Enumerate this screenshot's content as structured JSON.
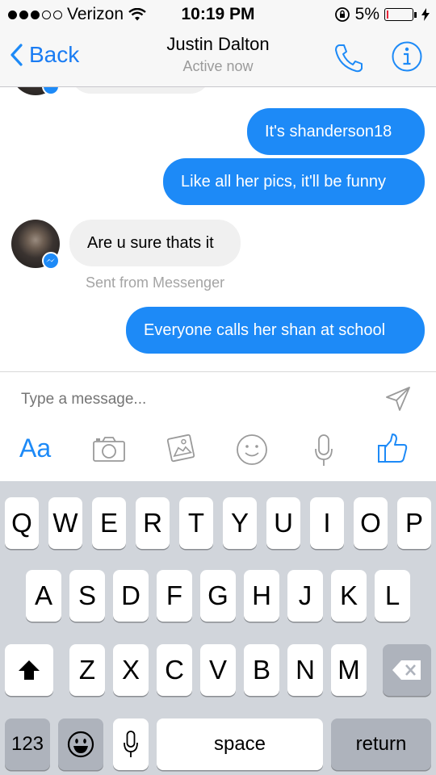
{
  "status_bar": {
    "carrier": "Verizon",
    "time": "10:19 PM",
    "battery": "5%",
    "battery_level": 0.05,
    "signal_bars_filled": 3,
    "signal_bars_total": 5
  },
  "nav": {
    "back_label": "Back",
    "title": "Justin Dalton",
    "subtitle": "Active now",
    "accent_color": "#1d8af7"
  },
  "messages": [
    {
      "direction": "outgoing",
      "text": "It's shanderson18"
    },
    {
      "direction": "outgoing",
      "text": "Like all her pics, it'll be funny"
    },
    {
      "direction": "incoming",
      "text": "Are u sure thats it"
    },
    {
      "direction": "outgoing",
      "text": "Everyone calls her shan at school"
    }
  ],
  "sent_from": "Sent from Messenger",
  "composer": {
    "placeholder": "Type a message...",
    "aa_label": "Aa",
    "tools": [
      "aa-icon",
      "camera-icon",
      "photo-icon",
      "emoji-icon",
      "microphone-icon",
      "like-icon"
    ]
  },
  "keyboard": {
    "row1": [
      "Q",
      "W",
      "E",
      "R",
      "T",
      "Y",
      "U",
      "I",
      "O",
      "P"
    ],
    "row2": [
      "A",
      "S",
      "D",
      "F",
      "G",
      "H",
      "J",
      "K",
      "L"
    ],
    "row3": [
      "Z",
      "X",
      "C",
      "V",
      "B",
      "N",
      "M"
    ],
    "numbers_label": "123",
    "space_label": "space",
    "return_label": "return"
  }
}
